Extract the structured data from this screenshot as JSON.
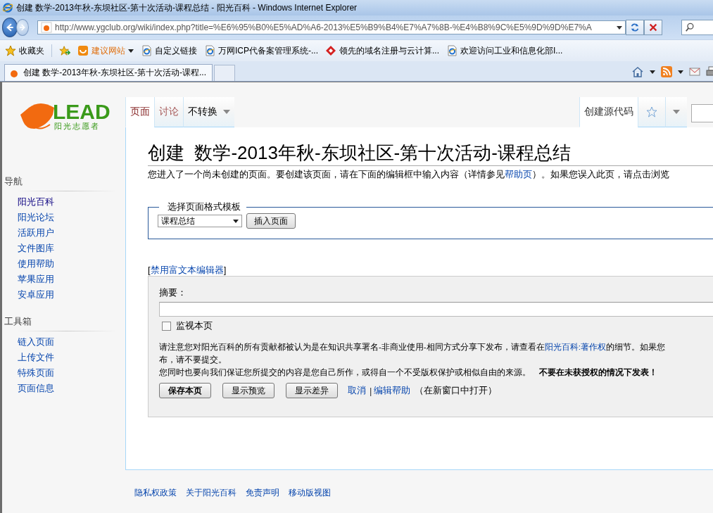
{
  "window": {
    "title": "创建 数学-2013年秋-东坝社区-第十次活动-课程总结 - 阳光百科 - Windows Internet Explorer"
  },
  "address_bar": {
    "url": "http://www.ygclub.org/wiki/index.php?title=%E6%95%B0%E5%AD%A6-2013%E5%B9%B4%E7%A7%8B-%E4%B8%9C%E5%9D%9D%E7%A"
  },
  "favorites_bar": {
    "label": "收藏夹",
    "items": [
      {
        "label": "建议网站",
        "kind": "suggested"
      },
      {
        "label": "自定义链接",
        "kind": "page"
      },
      {
        "label": "万网ICP代备案管理系统-...",
        "kind": "page"
      },
      {
        "label": "领先的域名注册与云计算...",
        "kind": "site"
      },
      {
        "label": "欢迎访问工业和信息化部I...",
        "kind": "page"
      }
    ]
  },
  "browser_tabs": [
    {
      "label": "创建 数学-2013年秋-东坝社区-第十次活动-课程...",
      "selected": true
    }
  ],
  "logo": {
    "wordmark": "LEAD",
    "tagline": "阳光志愿者"
  },
  "sidebar": [
    {
      "heading": "导航",
      "items": [
        {
          "label": "阳光百科",
          "visited": true
        },
        {
          "label": "阳光论坛",
          "visited": false
        },
        {
          "label": "活跃用户",
          "visited": false
        },
        {
          "label": "文件图库",
          "visited": false
        },
        {
          "label": "使用帮助",
          "visited": false
        },
        {
          "label": "苹果应用",
          "visited": false
        },
        {
          "label": "安卓应用",
          "visited": false
        }
      ]
    },
    {
      "heading": "工具箱",
      "items": [
        {
          "label": "链入页面",
          "visited": false
        },
        {
          "label": "上传文件",
          "visited": false
        },
        {
          "label": "特殊页面",
          "visited": false
        },
        {
          "label": "页面信息",
          "visited": false
        }
      ]
    }
  ],
  "page_tabs": [
    {
      "label": "页面",
      "selected": true
    },
    {
      "label": "讨论",
      "selected": false
    }
  ],
  "variant_menu": {
    "label": "不转换"
  },
  "view_tabs": [
    {
      "label": "创建源代码",
      "selected": true
    }
  ],
  "heading": "创建  数学-2013年秋-东坝社区-第十次活动-课程总结",
  "intro": {
    "before": "您进入了一个尚未创建的页面。要创建该页面，请在下面的编辑框中输入内容（详情参见",
    "link": "帮助页",
    "after": "）。如果您误入此页，请点击浏览"
  },
  "template": {
    "legend": "选择页面格式模板",
    "select": "课程总结",
    "button": "插入页面"
  },
  "editor_toggle": {
    "open": "[",
    "link": "禁用富文本编辑器",
    "close": "]"
  },
  "edit_form": {
    "summary_label": "摘要：",
    "watch": {
      "label": "监视本页",
      "checked": false
    },
    "notice": {
      "before": "请注意您对阳光百科的所有贡献都被认为是在知识共享署名-非商业使用-相同方式分享下发布，请查看在",
      "link": "阳光百科:著作权",
      "after": "的细节。如果您",
      "line2": "布，请不要提交。"
    },
    "warning": "您同时也要向我们保证您所提交的内容是您自己所作，或得自一个不受版权保护或相似自由的来源。　**不要在未获授权的情况下发表！**",
    "buttons": [
      {
        "label": "保存本页",
        "kind": "primary"
      },
      {
        "label": "显示预览",
        "kind": "normal"
      },
      {
        "label": "显示差异",
        "kind": "normal"
      }
    ],
    "links": [
      "取消",
      "编辑帮助"
    ],
    "separator": "|",
    "note": "（在新窗口中打开）"
  },
  "footer": [
    "隐私权政策",
    "关于阳光百科",
    "免责声明",
    "移动版视图"
  ]
}
